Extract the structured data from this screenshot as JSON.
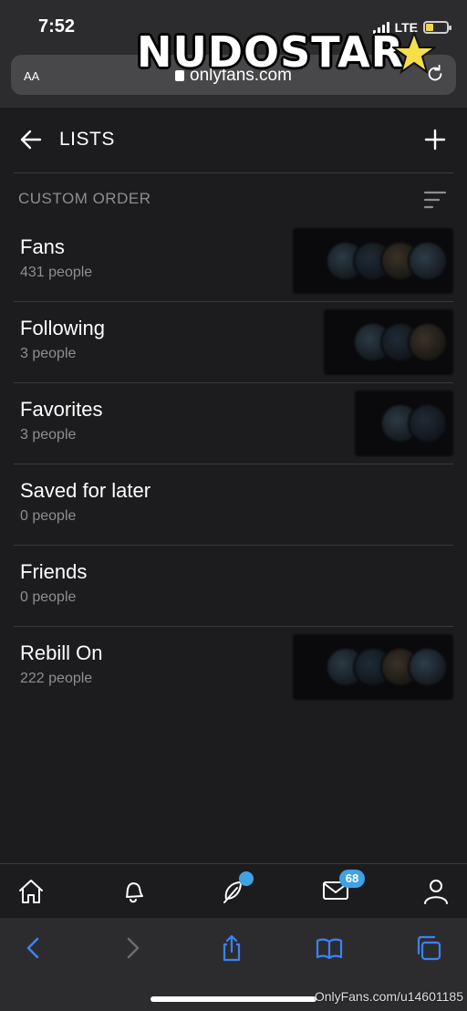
{
  "status": {
    "time": "7:52",
    "network": "LTE"
  },
  "watermark": {
    "text": "NUDOSTAR"
  },
  "browser": {
    "aa_label": "AA",
    "url": "onlyfans.com"
  },
  "header": {
    "title": "LISTS"
  },
  "order": {
    "label": "CUSTOM ORDER"
  },
  "lists": [
    {
      "name": "Fans",
      "count": "431 people",
      "avatars": 4
    },
    {
      "name": "Following",
      "count": "3 people",
      "avatars": 3
    },
    {
      "name": "Favorites",
      "count": "3 people",
      "avatars": 2
    },
    {
      "name": "Saved for later",
      "count": "0 people",
      "avatars": 0
    },
    {
      "name": "Friends",
      "count": "0 people",
      "avatars": 0
    },
    {
      "name": "Rebill On",
      "count": "222 people",
      "avatars": 4
    }
  ],
  "tabs": {
    "messages_badge": "68"
  },
  "credit": "OnlyFans.com/u14601185",
  "colors": {
    "background": "#1c1c1e",
    "accent": "#3fa2e4",
    "muted_text": "#8e8e93",
    "divider": "#3a3a3c"
  }
}
